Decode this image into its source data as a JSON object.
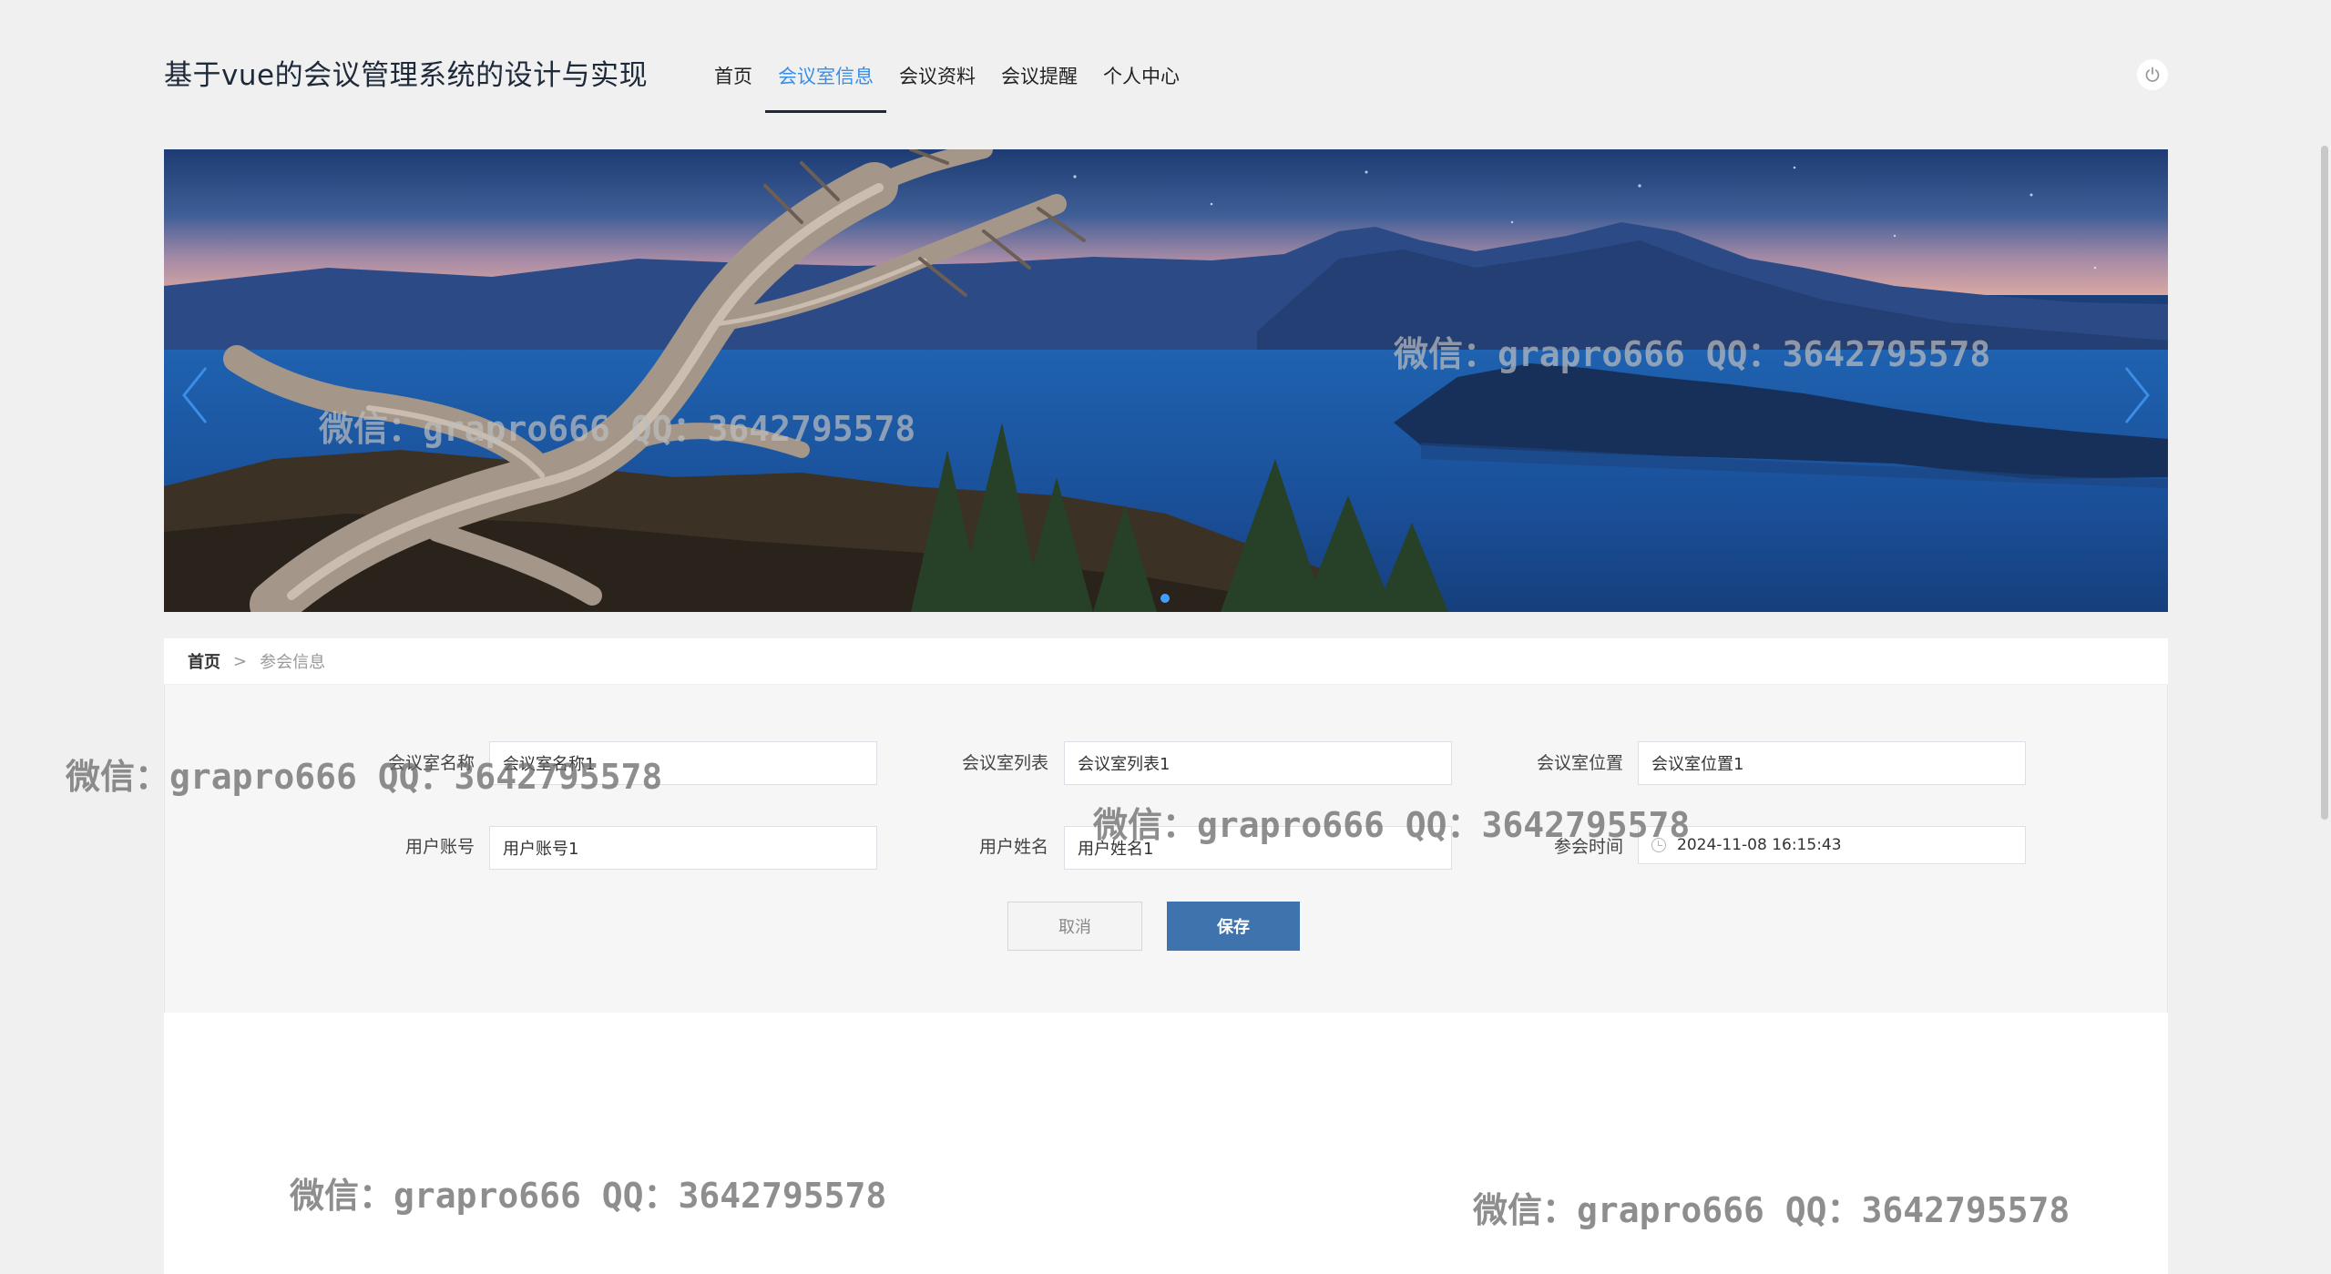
{
  "header": {
    "title": "基于vue的会议管理系统的设计与实现",
    "nav": [
      {
        "label": "首页",
        "active": false
      },
      {
        "label": "会议室信息",
        "active": true
      },
      {
        "label": "会议资料",
        "active": false
      },
      {
        "label": "会议提醒",
        "active": false
      },
      {
        "label": "个人中心",
        "active": false
      }
    ],
    "power_icon": "power-icon",
    "accent_color": "#3a8ee6"
  },
  "carousel": {
    "prev_icon": "chevron-left-icon",
    "next_icon": "chevron-right-icon",
    "image": "lake-mountain-twilight-landscape",
    "active_dot_color": "#409eff"
  },
  "breadcrumb": {
    "home": "首页",
    "separator": ">",
    "current": "参会信息"
  },
  "form": {
    "fields": [
      {
        "label": "会议室名称",
        "value": "会议室名称1"
      },
      {
        "label": "会议室列表",
        "value": "会议室列表1"
      },
      {
        "label": "会议室位置",
        "value": "会议室位置1"
      },
      {
        "label": "用户账号",
        "value": "用户账号1"
      },
      {
        "label": "用户姓名",
        "value": "用户姓名1"
      },
      {
        "label": "参会时间",
        "value": "2024-11-08 16:15:43",
        "icon": "clock-icon"
      }
    ],
    "cancel_label": "取消",
    "save_label": "保存",
    "save_color": "#3e73ad"
  },
  "watermark": {
    "text": "微信：grapro666 QQ：3642795578"
  }
}
